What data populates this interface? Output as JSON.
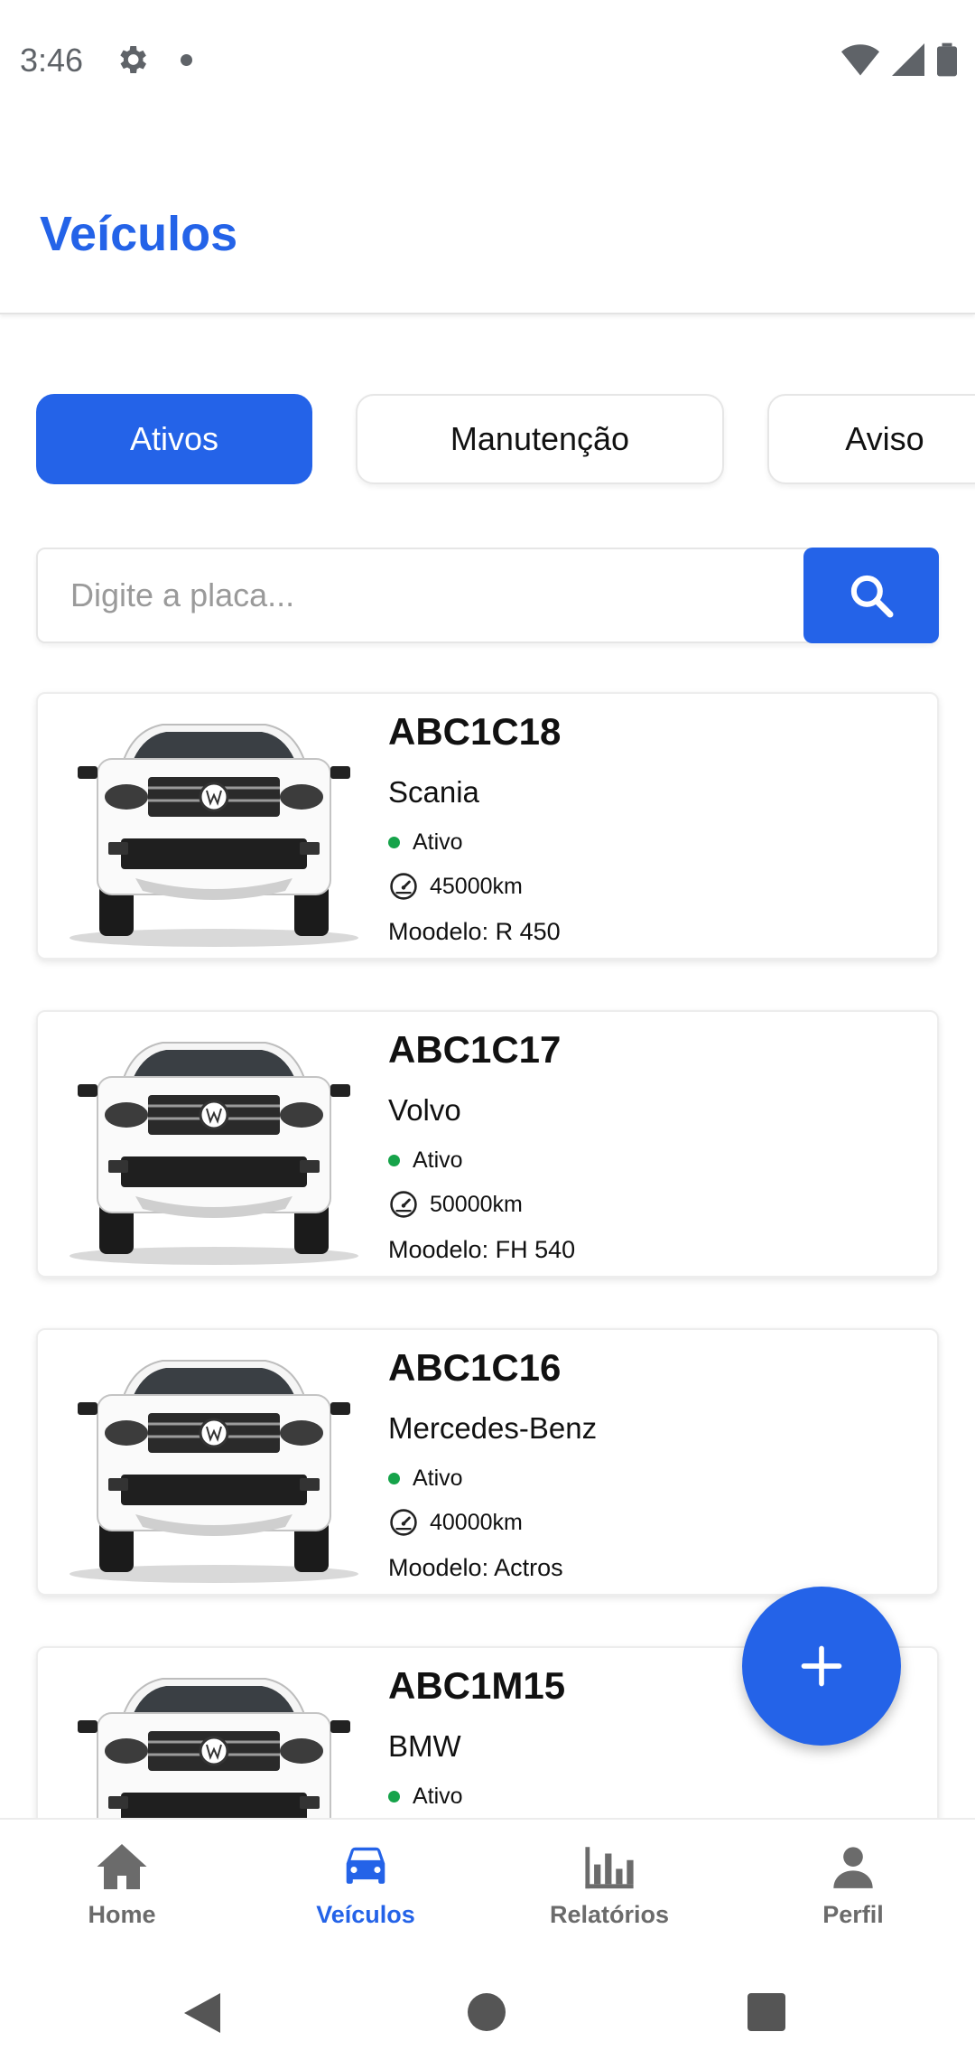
{
  "status_bar": {
    "time": "3:46"
  },
  "header": {
    "title": "Veículos"
  },
  "tabs": [
    {
      "label": "Ativos",
      "active": true
    },
    {
      "label": "Manutenção",
      "active": false
    },
    {
      "label": "Aviso",
      "active": false
    }
  ],
  "search": {
    "placeholder": "Digite a placa...",
    "value": ""
  },
  "vehicles": [
    {
      "plate": "ABC1C18",
      "brand": "Scania",
      "status": "Ativo",
      "km": "45000km",
      "model": "Moodelo: R 450"
    },
    {
      "plate": "ABC1C17",
      "brand": "Volvo",
      "status": "Ativo",
      "km": "50000km",
      "model": "Moodelo: FH 540"
    },
    {
      "plate": "ABC1C16",
      "brand": "Mercedes-Benz",
      "status": "Ativo",
      "km": "40000km",
      "model": "Moodelo: Actros"
    },
    {
      "plate": "ABC1M15",
      "brand": "BMW",
      "status": "Ativo",
      "km": "",
      "model": ""
    }
  ],
  "bottom_nav": [
    {
      "label": "Home",
      "icon": "home-icon",
      "active": false
    },
    {
      "label": "Veículos",
      "icon": "car-icon",
      "active": true
    },
    {
      "label": "Relatórios",
      "icon": "bar-chart-icon",
      "active": false
    },
    {
      "label": "Perfil",
      "icon": "person-icon",
      "active": false
    }
  ],
  "colors": {
    "primary": "#2463e8",
    "status_active": "#16a34a",
    "nav_inactive": "#6b6b6b"
  }
}
